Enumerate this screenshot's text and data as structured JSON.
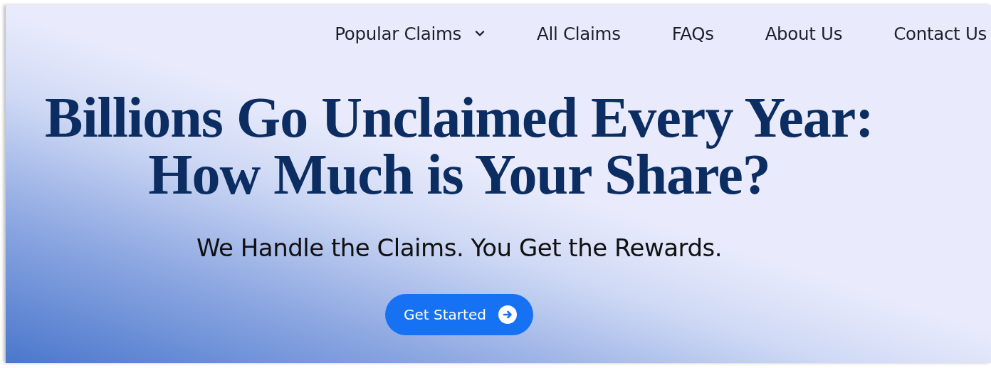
{
  "nav": {
    "items": [
      {
        "label": "Popular Claims",
        "has_dropdown": true
      },
      {
        "label": "All Claims",
        "has_dropdown": false
      },
      {
        "label": "FAQs",
        "has_dropdown": false
      },
      {
        "label": "About Us",
        "has_dropdown": false
      },
      {
        "label": "Contact Us",
        "has_dropdown": false
      }
    ]
  },
  "hero": {
    "title_lines": [
      "Billions Go Unclaimed Every Year:",
      "How Much is Your Share?"
    ],
    "subtitle": "We Handle the Claims. You Get the Rewards.",
    "cta": {
      "label": "Get Started"
    }
  }
}
